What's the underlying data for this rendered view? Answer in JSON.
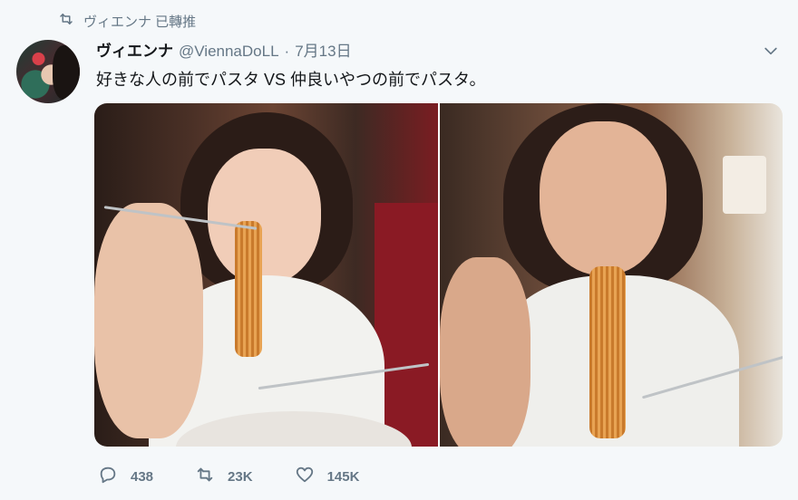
{
  "retweet_context": {
    "icon": "retweet-icon",
    "text": "ヴィエンナ 已轉推"
  },
  "author": {
    "display_name": "ヴィエンナ",
    "handle": "@ViennaDoLL",
    "separator": "·",
    "date": "7月13日"
  },
  "tweet": {
    "text": "好きな人の前でパスタ VS 仲良いやつの前でパスタ。"
  },
  "media": {
    "photos": [
      "photo-1",
      "photo-2"
    ]
  },
  "actions": {
    "reply": {
      "icon": "reply-icon",
      "count": "438"
    },
    "retweet": {
      "icon": "retweet-icon",
      "count": "23K"
    },
    "like": {
      "icon": "heart-icon",
      "count": "145K"
    }
  },
  "colors": {
    "background": "#f5f8fa",
    "text": "#14171a",
    "muted": "#657786"
  }
}
